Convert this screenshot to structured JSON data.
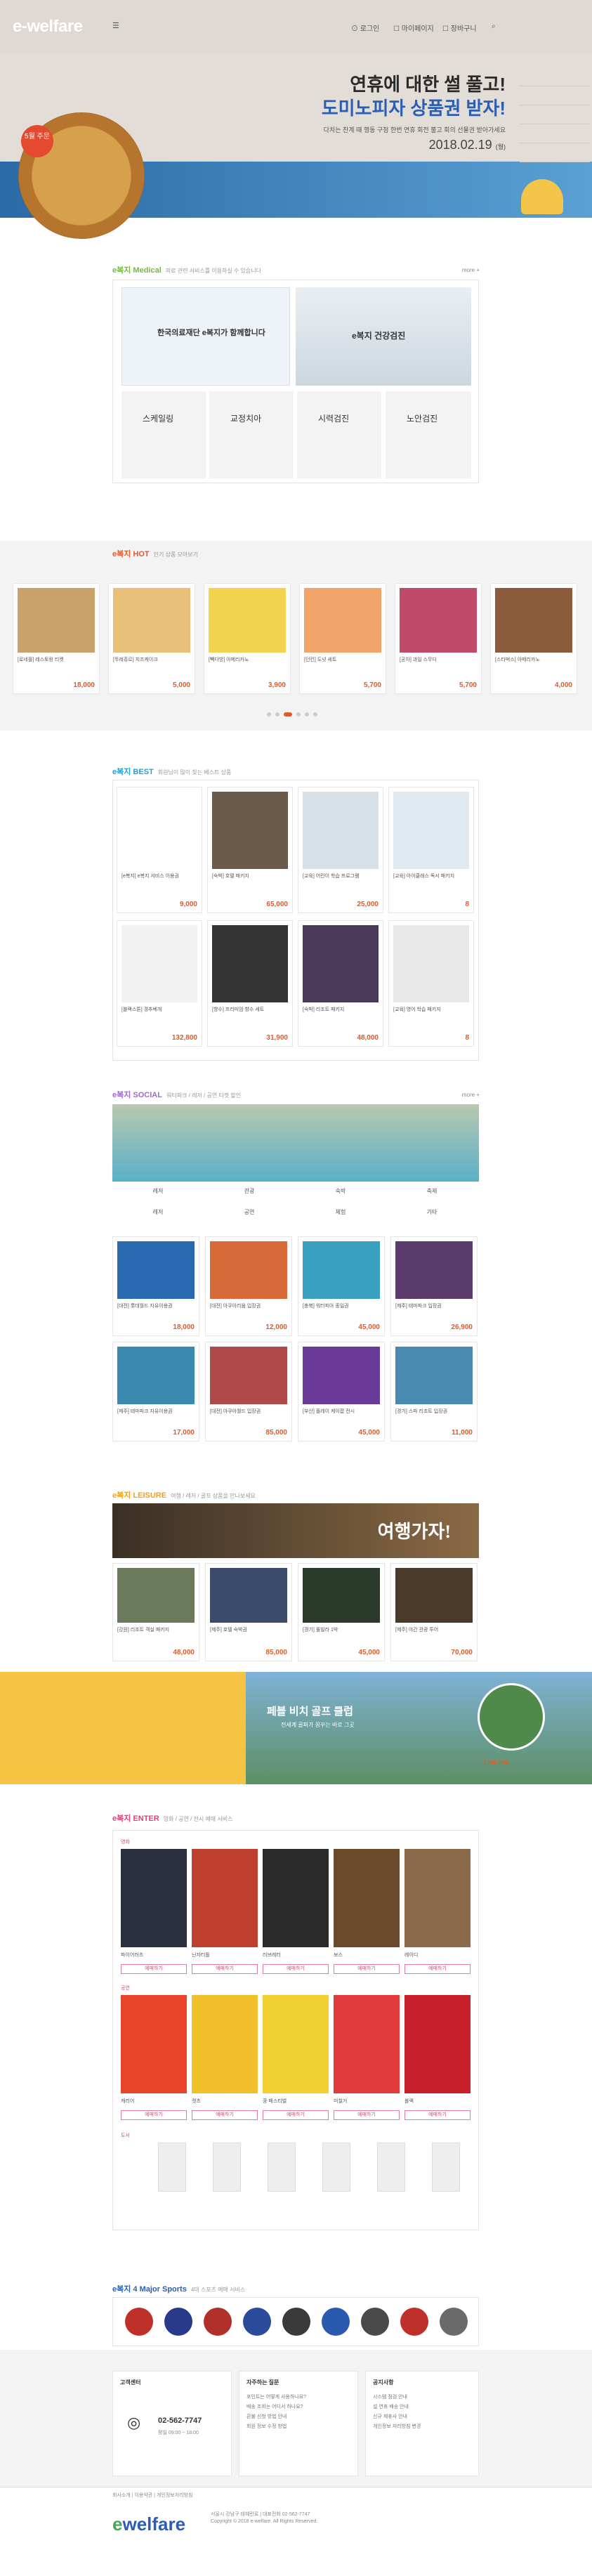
{
  "brand": {
    "logo": "e-welfare",
    "name": "welfare"
  },
  "hero": {
    "badge": "5월 주문",
    "title1": "연휴에 대한 썰 풀고!",
    "title2": "도미노피자 상품권 받자!",
    "sub": "다치는 찬계 때 행동 구청 한번 연휴 회전 불고 회의 선물권 받아가세요",
    "date": "2018.02.19",
    "date_suffix": "(월)"
  },
  "medical": {
    "label": "e복지 Medical",
    "sub": "의료 관련 서비스를 이용하실 수 있습니다",
    "more": "more +",
    "tiles": [
      "한국의료재단 e복지가 함께합니다",
      "e복지 건강검진",
      "스케일링",
      "교정치아",
      "시력검진",
      "노안검진"
    ]
  },
  "hot": {
    "label": "e복지 HOT",
    "sub": "인기 상품 모아보기",
    "items": [
      {
        "name": "[로네플] 레스토랑 티켓",
        "price": "18,000"
      },
      {
        "name": "[뚜레쥬르] 치즈케이크",
        "price": "5,000"
      },
      {
        "name": "[빽다방] 아메리카노",
        "price": "3,900"
      },
      {
        "name": "[던킨] 도넛 세트",
        "price": "5,700"
      },
      {
        "name": "[공차] 과일 스무디",
        "price": "5,700"
      },
      {
        "name": "[스타벅스] 아메리카노",
        "price": "4,000"
      }
    ]
  },
  "best": {
    "label": "e복지 BEST",
    "sub": "회원님이 많이 찾는 베스트 상품",
    "items": [
      {
        "name": "[e복지] e복지 서비스 이용권",
        "price": "9,000"
      },
      {
        "name": "[숙박] 호텔 패키지",
        "price": "65,000"
      },
      {
        "name": "[교육] 어린이 학습 프로그램",
        "price": "25,000"
      },
      {
        "name": "[교육] 아이클래스 독서 패키지",
        "price": "8"
      },
      {
        "name": "[블랙스톤] 경추베개",
        "price": "132,800"
      },
      {
        "name": "[향수] 프리미엄 향수 세트",
        "price": "31,900"
      },
      {
        "name": "[숙박] 리조트 패키지",
        "price": "48,000"
      },
      {
        "name": "[교육] 영어 학습 패키지",
        "price": "8"
      }
    ]
  },
  "social": {
    "label": "e복지 SOCIAL",
    "sub": "워터파크 / 레저 / 공연 티켓 할인",
    "more": "more +",
    "cats": [
      "레저",
      "관광",
      "숙박",
      "축제",
      "레저",
      "공연",
      "체험",
      "기타"
    ],
    "items": [
      {
        "name": "[대전] 롯데월드 자유이용권",
        "price": "18,000"
      },
      {
        "name": "[대전] 아쿠아리움 입장권",
        "price": "12,000"
      },
      {
        "name": "[충북] 워터피아 종일권",
        "price": "45,000"
      },
      {
        "name": "[제주] 테마파크 입장권",
        "price": "26,900"
      },
      {
        "name": "[제주] 테마파크 자유이용권",
        "price": "17,000"
      },
      {
        "name": "[대전] 아쿠아월드 입장권",
        "price": "85,000"
      },
      {
        "name": "[부산] 플레이 케이팝 전시",
        "price": "45,000"
      },
      {
        "name": "[경기] 스파 리조트 입장권",
        "price": "11,000"
      }
    ]
  },
  "leisure": {
    "label": "e복지 LEISURE",
    "sub": "여행 / 레저 / 골프 상품을 만나보세요",
    "banner": "여행가자!",
    "items": [
      {
        "name": "[강원] 리조트 객실 패키지",
        "price": "48,000"
      },
      {
        "name": "[제주] 호텔 숙박권",
        "price": "85,000"
      },
      {
        "name": "[경기] 풀빌라 1박",
        "price": "45,000"
      },
      {
        "name": "[제주] 야간 관광 투어",
        "price": "70,000"
      }
    ]
  },
  "golf": {
    "title": "페블 비치 골프 클럽",
    "sub": "전세계 골퍼가 꿈꾸는 바로 그곳",
    "price": "2,000,000"
  },
  "enter": {
    "label": "e복지 ENTER",
    "sub": "영화 / 공연 / 전시 예매 서비스",
    "btn": "예매하기",
    "r1": "영화",
    "r2": "공연",
    "r3": "도서",
    "movies": [
      "파이어러츠",
      "닌자터틀",
      "러브레터",
      "보스",
      "레이디"
    ],
    "shows": [
      "캐리어",
      "캣츠",
      "쿵 페스티벌",
      "미칠거",
      "블랙"
    ]
  },
  "sports": {
    "label": "e복지 4 Major Sports",
    "sub": "4대 스포츠 예매 서비스"
  },
  "cs": {
    "title": "고객센터",
    "phone": "02-562-7747",
    "hours": "평일 09:00 ~ 18:00",
    "t2": "자주하는 질문",
    "t3": "공지사항",
    "faq": [
      "포인트는 어떻게 사용하나요?",
      "배송 조회는 어디서 하나요?",
      "환불 신청 방법 안내",
      "회원 정보 수정 방법"
    ],
    "notice": [
      "시스템 점검 안내",
      "설 연휴 배송 안내",
      "신규 제휴사 안내",
      "개인정보 처리방침 변경"
    ]
  },
  "footer": {
    "links": "회사소개 | 이용약관 | 개인정보처리방침",
    "addr": "서울시 강남구 테헤란로 | 대표전화 02-562-7747",
    "copy": "Copyright © 2018 e-welfare. All Rights Reserved."
  },
  "colors": {
    "blue": "#2b5db2",
    "orange": "#e05a2a",
    "medical": "#7ab648",
    "hot": "#e05a2a",
    "best": "#2b9bd6",
    "social": "#9a6ad0",
    "leisure": "#f0a020",
    "enter": "#e0427a",
    "sports": "#2b5db2"
  }
}
